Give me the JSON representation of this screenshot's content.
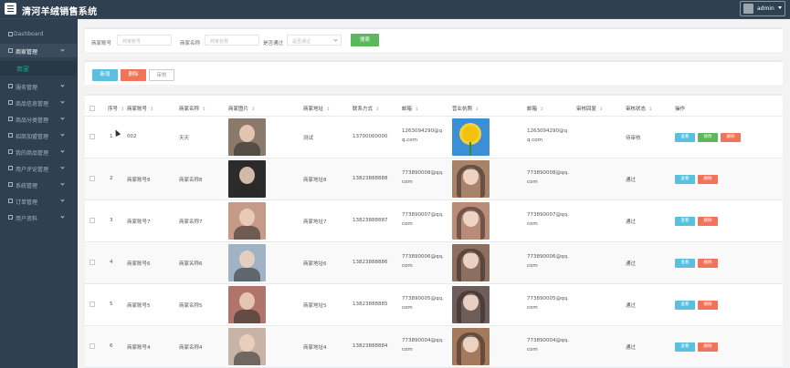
{
  "app": {
    "title": "清河羊绒销售系统",
    "user": "admin"
  },
  "sidebar": {
    "items": [
      {
        "label": "Dashboard",
        "icon": "home-icon"
      },
      {
        "label": "商家管理",
        "icon": "store-icon",
        "active": true
      },
      {
        "label": "服务管理",
        "icon": "grid-icon"
      },
      {
        "label": "商品信息管理",
        "icon": "box-icon"
      },
      {
        "label": "商品分类管理",
        "icon": "tag-icon"
      },
      {
        "label": "招商加盟管理",
        "icon": "handshake-icon"
      },
      {
        "label": "我的商品管理",
        "icon": "cart-icon"
      },
      {
        "label": "用户评论管理",
        "icon": "comment-icon"
      },
      {
        "label": "系统管理",
        "icon": "gear-icon"
      },
      {
        "label": "订单管理",
        "icon": "order-icon"
      },
      {
        "label": "用户资料",
        "icon": "user-icon"
      }
    ],
    "sub_item": "商家"
  },
  "search": {
    "account_label": "商家账号",
    "account_placeholder": "商家账号",
    "name_label": "商家名称",
    "name_placeholder": "商家名称",
    "pass_label": "是否通过",
    "pass_placeholder": "是否通过",
    "button": "搜索"
  },
  "actions": {
    "add": "新增",
    "delete": "删除",
    "review": "审核"
  },
  "table": {
    "headers": [
      "序号",
      "商家账号",
      "商家名称",
      "商家图片",
      "商家地址",
      "联系方式",
      "邮箱",
      "营业执照",
      "邮箱",
      "审核回复",
      "审核状态",
      "操作"
    ],
    "rows": [
      {
        "no": "1",
        "account": "002",
        "name": "天天",
        "address": "测试",
        "phone": "13700000000",
        "email_a": "1263094290@q",
        "email_b": "q.com",
        "email2_a": "1263094290@q",
        "email2_b": "q.com",
        "status": "待审核",
        "photo": "#8b7a6c",
        "license": "#3a8fd6",
        "ops": [
          "查看",
          "修改",
          "删除"
        ]
      },
      {
        "no": "2",
        "account": "商家账号8",
        "name": "商家名称8",
        "address": "商家地址8",
        "phone": "13823888888",
        "email_a": "773890008@qq.",
        "email_b": "com",
        "email2_a": "773890008@qq.",
        "email2_b": "com",
        "status": "通过",
        "photo": "#2b2b2b",
        "license": "#a8836a",
        "ops": [
          "查看",
          "删除"
        ]
      },
      {
        "no": "3",
        "account": "商家账号7",
        "name": "商家名称7",
        "address": "商家地址7",
        "phone": "13823888887",
        "email_a": "773890007@qq.",
        "email_b": "com",
        "email2_a": "773890007@qq.",
        "email2_b": "com",
        "status": "通过",
        "photo": "#c59a86",
        "license": "#b98c78",
        "ops": [
          "查看",
          "删除"
        ]
      },
      {
        "no": "4",
        "account": "商家账号6",
        "name": "商家名称6",
        "address": "商家地址6",
        "phone": "13823888886",
        "email_a": "773890006@qq.",
        "email_b": "com",
        "email2_a": "773890006@qq.",
        "email2_b": "com",
        "status": "通过",
        "photo": "#9fb3c4",
        "license": "#8c6f5f",
        "ops": [
          "查看",
          "删除"
        ]
      },
      {
        "no": "5",
        "account": "商家账号5",
        "name": "商家名称5",
        "address": "商家地址5",
        "phone": "13823888885",
        "email_a": "773890005@qq.",
        "email_b": "com",
        "email2_a": "773890005@qq.",
        "email2_b": "com",
        "status": "通过",
        "photo": "#b0756a",
        "license": "#6e5d58",
        "ops": [
          "查看",
          "删除"
        ]
      },
      {
        "no": "6",
        "account": "商家账号4",
        "name": "商家名称4",
        "address": "商家地址4",
        "phone": "13823888884",
        "email_a": "773890004@qq.",
        "email_b": "com",
        "email2_a": "773890004@qq.",
        "email2_b": "com",
        "status": "通过",
        "photo": "#c8b4a6",
        "license": "#a57a5c",
        "ops": [
          "查看",
          "删除"
        ]
      }
    ]
  },
  "colors": {
    "sidebar": "#2f4050",
    "accent": "#19aa8d",
    "view": "#5bc0de",
    "edit": "#5cb85c",
    "delete": "#f0735a"
  }
}
